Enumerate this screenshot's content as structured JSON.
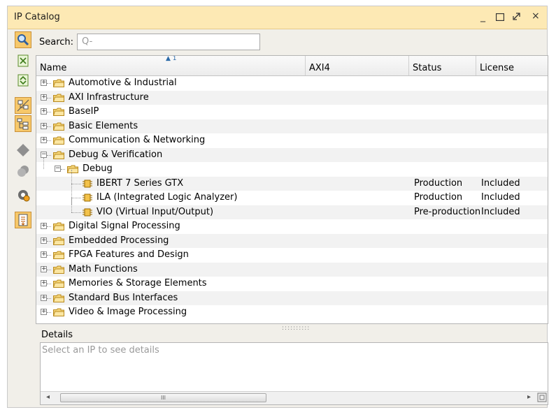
{
  "window": {
    "title": "IP Catalog",
    "controls": [
      "minimize-icon",
      "maximize-icon",
      "restore-icon",
      "close-icon"
    ]
  },
  "toolbar": {
    "buttons": [
      {
        "name": "search-button",
        "icon": "magnifier-icon",
        "active": true
      },
      {
        "name": "collapse-all-button",
        "icon": "collapse-all-icon"
      },
      {
        "name": "expand-all-button",
        "icon": "expand-all-icon"
      },
      {
        "name": "toggle-view-button",
        "icon": "tree-view-icon",
        "active": true
      },
      {
        "name": "group-by-button",
        "icon": "hierarchy-icon",
        "active": true
      },
      {
        "name": "ip-button",
        "icon": "gray-diamond-icon"
      },
      {
        "name": "repository-button",
        "icon": "stacked-discs-icon"
      },
      {
        "name": "settings-button",
        "icon": "gear-icon"
      },
      {
        "name": "report-button",
        "icon": "document-icon",
        "active": true
      }
    ]
  },
  "search": {
    "label": "Search:",
    "placeholder": "Q-"
  },
  "table": {
    "columns": [
      "Name",
      "AXI4",
      "Status",
      "License"
    ],
    "sort_indicator": "1",
    "rows": [
      {
        "name": "Automotive & Industrial",
        "level": 0,
        "type": "folder",
        "expanded": false
      },
      {
        "name": "AXI Infrastructure",
        "level": 0,
        "type": "folder",
        "expanded": false
      },
      {
        "name": "BaseIP",
        "level": 0,
        "type": "folder",
        "expanded": false
      },
      {
        "name": "Basic Elements",
        "level": 0,
        "type": "folder",
        "expanded": false
      },
      {
        "name": "Communication & Networking",
        "level": 0,
        "type": "folder",
        "expanded": false
      },
      {
        "name": "Debug & Verification",
        "level": 0,
        "type": "folder",
        "expanded": true
      },
      {
        "name": "Debug",
        "level": 1,
        "type": "folder",
        "expanded": true
      },
      {
        "name": "IBERT 7 Series GTX",
        "level": 2,
        "type": "ip",
        "status": "Production",
        "license": "Included"
      },
      {
        "name": "ILA (Integrated Logic Analyzer)",
        "level": 2,
        "type": "ip",
        "status": "Production",
        "license": "Included"
      },
      {
        "name": "VIO (Virtual Input/Output)",
        "level": 2,
        "type": "ip",
        "status": "Pre-production",
        "license": "Included"
      },
      {
        "name": "Digital Signal Processing",
        "level": 0,
        "type": "folder",
        "expanded": false
      },
      {
        "name": "Embedded Processing",
        "level": 0,
        "type": "folder",
        "expanded": false
      },
      {
        "name": "FPGA Features and Design",
        "level": 0,
        "type": "folder",
        "expanded": false
      },
      {
        "name": "Math Functions",
        "level": 0,
        "type": "folder",
        "expanded": false
      },
      {
        "name": "Memories & Storage Elements",
        "level": 0,
        "type": "folder",
        "expanded": false
      },
      {
        "name": "Standard Bus Interfaces",
        "level": 0,
        "type": "folder",
        "expanded": false
      },
      {
        "name": "Video & Image Processing",
        "level": 0,
        "type": "folder",
        "expanded": false
      }
    ]
  },
  "details": {
    "label": "Details",
    "placeholder": "Select an IP to see details"
  },
  "scrollbar": {
    "thumb_grip": "III"
  },
  "colors": {
    "titlebar": "#fde9b4",
    "active_button": "#f7c86a",
    "folder": "#f3c85a"
  }
}
